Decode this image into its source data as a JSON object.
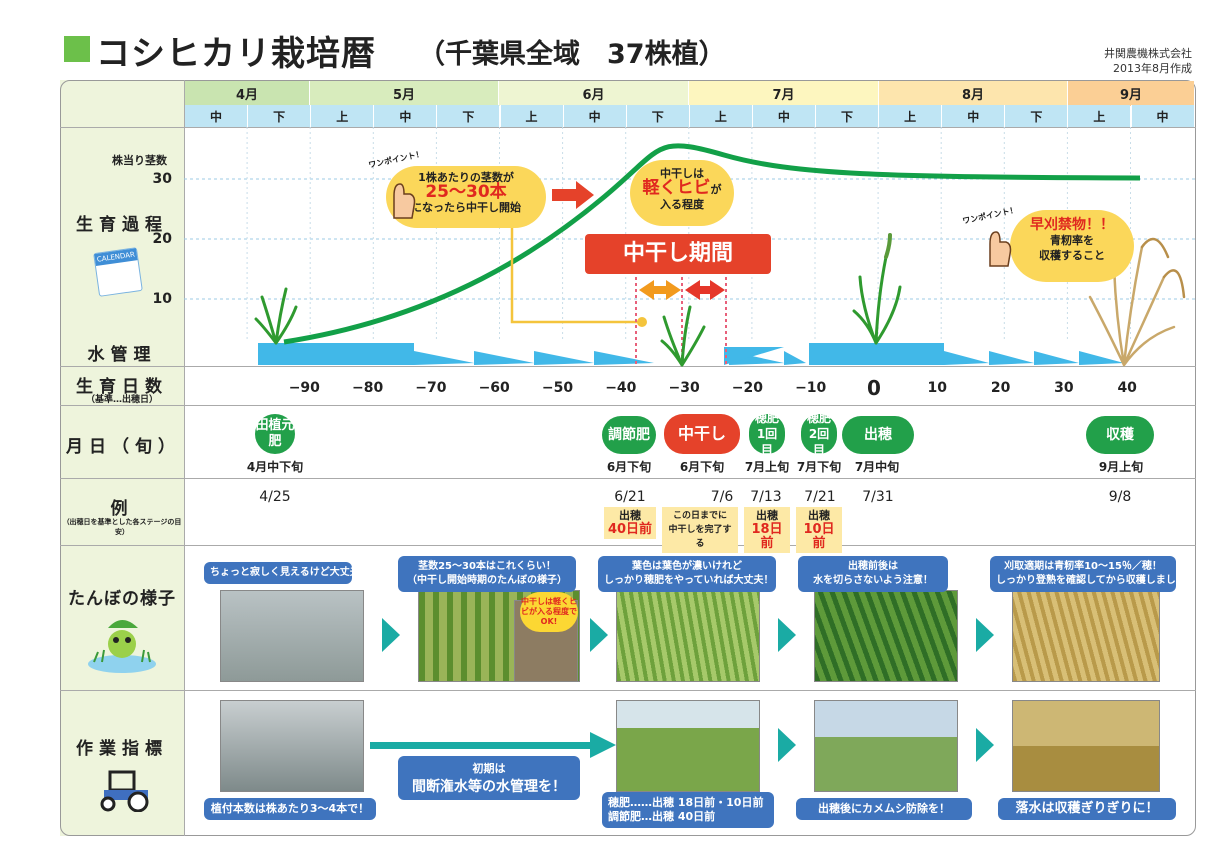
{
  "header": {
    "title": "コシヒカリ栽培暦",
    "subtitle": "（千葉県全域　37株植）",
    "company": "井関農機株式会社",
    "created": "2013年8月作成"
  },
  "months": [
    {
      "label": "4月",
      "color": "#c9e4b0"
    },
    {
      "label": "5月",
      "color": "#d8ecbd"
    },
    {
      "label": "6月",
      "color": "#eef5d2"
    },
    {
      "label": "7月",
      "color": "#fdf6bf"
    },
    {
      "label": "8月",
      "color": "#fde5ad"
    },
    {
      "label": "9月",
      "color": "#fbcf95"
    }
  ],
  "segments": [
    "中",
    "下",
    "上",
    "中",
    "下",
    "上",
    "中",
    "下",
    "上",
    "中",
    "下",
    "上",
    "中",
    "下",
    "上",
    "中"
  ],
  "row_labels": {
    "growth": "生育過程",
    "water": "水管理",
    "days": "生育日数",
    "days_sub": "（基準…出穂日）",
    "date": "月日（旬）",
    "example": "例",
    "example_sub": "（出穂日を基準とした各ステージの目安）",
    "paddy": "たんぼの様子",
    "work": "作業指標"
  },
  "y_axis": {
    "title": "株当り茎数",
    "ticks": [
      "30",
      "20",
      "10"
    ]
  },
  "calendar_icon": "CALENDAR",
  "day_ticks": [
    "−90",
    "−80",
    "−70",
    "−60",
    "−50",
    "−40",
    "−30",
    "−20",
    "−10",
    "0",
    "10",
    "20",
    "30",
    "40"
  ],
  "callouts": {
    "onepoint": "ワンポイント！",
    "bubble1_top": "1株あたりの茎数が",
    "bubble1_mid": "25〜30本",
    "bubble1_bot": "になったら中干し開始",
    "bubble2_top": "中干しは",
    "bubble2_mid": "軽くヒビ",
    "bubble2_mid2": "が",
    "bubble2_bot": "入る程度",
    "period": "中干し期間",
    "bubble3_mid": "早刈禁物！！",
    "bubble3_bot1": "青籾率を",
    "bubble3_bot2": "収穫すること"
  },
  "stages": [
    {
      "label": "田植元肥",
      "date": "4月中下旬",
      "example": "4/25"
    },
    {
      "label": "調節肥",
      "date": "6月下旬",
      "example": "6/21"
    },
    {
      "label": "中干し",
      "date": "6月下旬",
      "example": "7/6"
    },
    {
      "label": "穂肥1回目",
      "date": "7月上旬",
      "example": "7/13"
    },
    {
      "label": "穂肥2回目",
      "date": "7月下旬",
      "example": "7/21"
    },
    {
      "label": "出穂",
      "date": "7月中旬",
      "example": "7/31"
    },
    {
      "label": "収穫",
      "date": "9月上旬",
      "example": "9/8"
    }
  ],
  "before_boxes": [
    {
      "top": "出穂",
      "value": "40日前"
    },
    {
      "top": "この日までに",
      "value": "中干しを完了する"
    },
    {
      "top": "出穂",
      "value": "18日前"
    },
    {
      "top": "出穂",
      "value": "10日前"
    }
  ],
  "paddy": [
    {
      "line1": "ちょっと寂しく見えるけど大丈夫!",
      "line2": ""
    },
    {
      "line1": "茎数25〜30本はこれくらい！",
      "line2": "（中干し開始時期のたんぼの様子）",
      "inset": "中干しは軽くヒビが入る程度でOK!"
    },
    {
      "line1": "葉色は葉色が濃いけれど",
      "line2": "しっかり穂肥をやっていれば大丈夫！"
    },
    {
      "line1": "出穂前後は",
      "line2": "水を切らさないよう注意！"
    },
    {
      "line1": "刈取適期は青籾率10〜15％／穂！",
      "line2": "しっかり登熟を確認してから収穫しましょう！"
    }
  ],
  "work": {
    "w1": "植付本数は株あたり3〜4本で！",
    "w2_top": "初期は",
    "w2_bot": "間断潅水等の水管理を！",
    "w3_l1": "穂肥……出穂 18日前・10日前",
    "w3_l2": "調節肥…出穂 40日前",
    "w4": "出穂後にカメムシ防除を！",
    "w5": "落水は収穫ぎりぎりに！"
  }
}
